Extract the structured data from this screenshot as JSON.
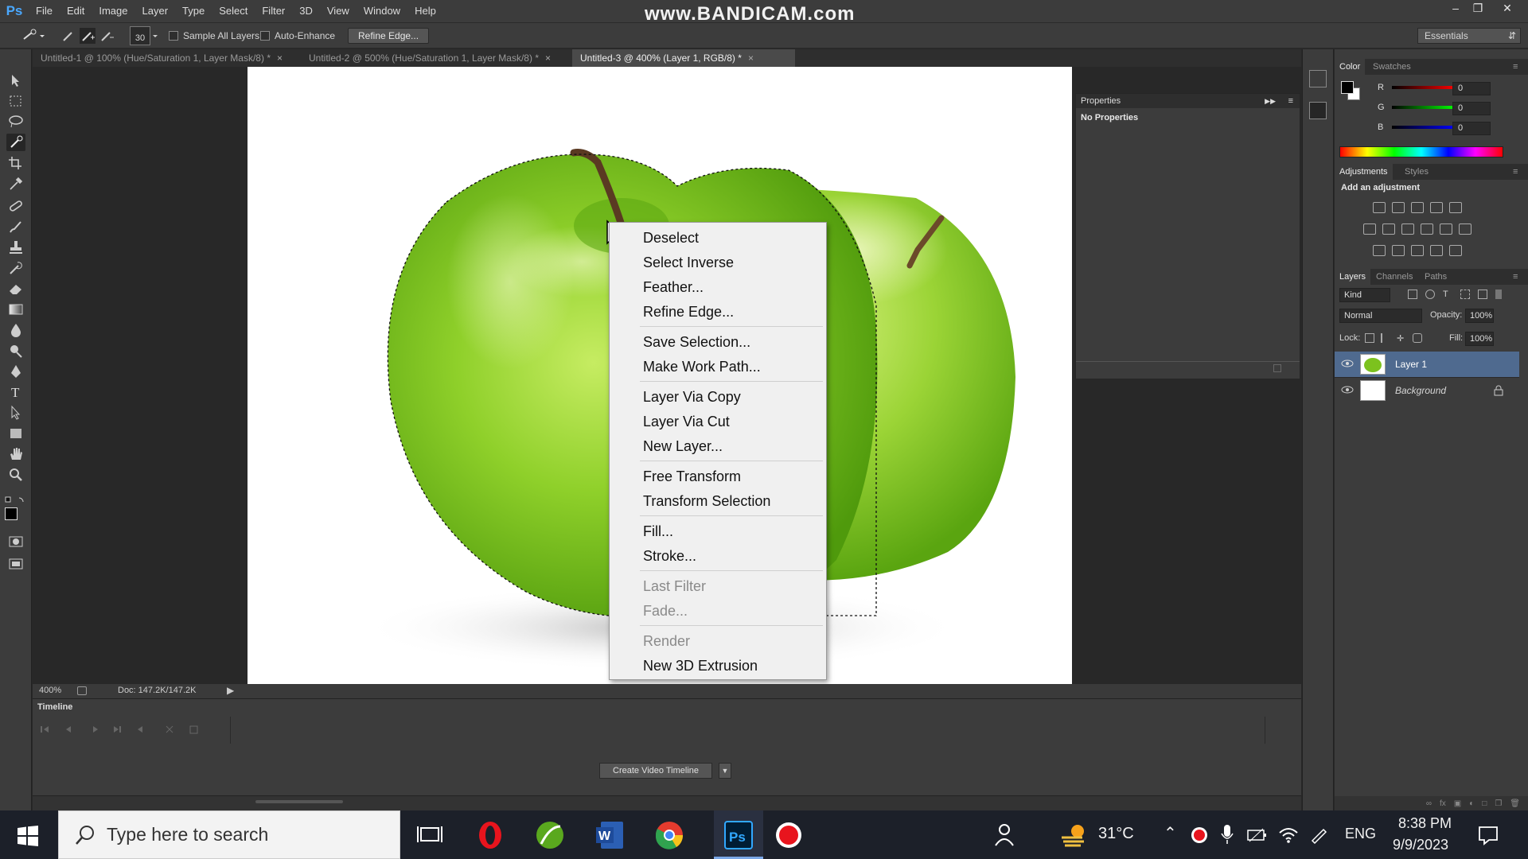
{
  "app": {
    "logo": "Ps",
    "menu": [
      "File",
      "Edit",
      "Image",
      "Layer",
      "Type",
      "Select",
      "Filter",
      "3D",
      "View",
      "Window",
      "Help"
    ],
    "watermark": "www.BANDICAM.com"
  },
  "options": {
    "brush_size": "30",
    "sample_all_layers": "Sample All Layers",
    "auto_enhance": "Auto-Enhance",
    "refine_edge": "Refine Edge...",
    "workspace": "Essentials"
  },
  "tabs": [
    {
      "label": "Untitled-1 @ 100% (Hue/Saturation 1, Layer Mask/8) *",
      "close": "×"
    },
    {
      "label": "Untitled-2 @ 500% (Hue/Saturation 1, Layer Mask/8) *",
      "close": "×"
    },
    {
      "label": "Untitled-3 @ 400% (Layer 1, RGB/8) *",
      "close": "×"
    }
  ],
  "context_menu": {
    "items": [
      {
        "label": "Deselect",
        "enabled": true
      },
      {
        "label": "Select Inverse",
        "enabled": true
      },
      {
        "label": "Feather...",
        "enabled": true
      },
      {
        "label": "Refine Edge...",
        "enabled": true
      },
      {
        "label": "Save Selection...",
        "enabled": true
      },
      {
        "label": "Make Work Path...",
        "enabled": true
      },
      {
        "label": "Layer Via Copy",
        "enabled": true
      },
      {
        "label": "Layer Via Cut",
        "enabled": true
      },
      {
        "label": "New Layer...",
        "enabled": true
      },
      {
        "label": "Free Transform",
        "enabled": true
      },
      {
        "label": "Transform Selection",
        "enabled": true
      },
      {
        "label": "Fill...",
        "enabled": true
      },
      {
        "label": "Stroke...",
        "enabled": true
      },
      {
        "label": "Last Filter",
        "enabled": false
      },
      {
        "label": "Fade...",
        "enabled": false
      },
      {
        "label": "Render",
        "enabled": false
      },
      {
        "label": "New 3D Extrusion",
        "enabled": true
      }
    ]
  },
  "status": {
    "zoom": "400%",
    "doc": "Doc: 147.2K/147.2K"
  },
  "timeline": {
    "title": "Timeline",
    "create_button": "Create Video Timeline"
  },
  "properties": {
    "title": "Properties",
    "body": "No Properties"
  },
  "color_panel": {
    "tabs": [
      "Color",
      "Swatches"
    ],
    "r_label": "R",
    "r_value": "0",
    "g_label": "G",
    "g_value": "0",
    "b_label": "B",
    "b_value": "0"
  },
  "adjustments_panel": {
    "tabs": [
      "Adjustments",
      "Styles"
    ],
    "heading": "Add an adjustment"
  },
  "layers_panel": {
    "tabs": [
      "Layers",
      "Channels",
      "Paths"
    ],
    "kind": "Kind",
    "blend_mode": "Normal",
    "opacity_label": "Opacity:",
    "opacity": "100%",
    "lock_label": "Lock:",
    "fill_label": "Fill:",
    "fill": "100%",
    "layers": [
      {
        "name": "Layer 1",
        "selected": true
      },
      {
        "name": "Background",
        "selected": false,
        "locked": true
      }
    ]
  },
  "taskbar": {
    "search_placeholder": "Type here to search",
    "temperature": "31°C",
    "language": "ENG",
    "time": "8:38 PM",
    "date": "9/9/2023"
  },
  "colors": {
    "accent_blue": "#4aa8ff",
    "selection_blue": "#4f6a8f",
    "apple_green": "#7cc21e"
  }
}
